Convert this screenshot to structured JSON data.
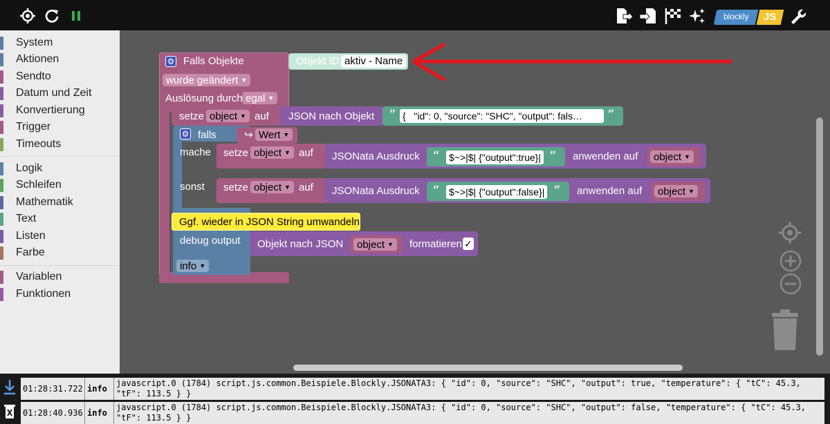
{
  "toolbar": {
    "icons_left": [
      "target-icon",
      "reload-icon",
      "pause-icon"
    ],
    "icons_right": [
      "export-icon",
      "import-icon",
      "checkered-flag-icon",
      "sparkle-icon",
      "wrench-icon"
    ],
    "mode_blockly_label": "blockly",
    "mode_js_label": "JS",
    "colors": {
      "pause": "#34b04b",
      "blockly": "#4a8cc7",
      "js": "#f4c430"
    }
  },
  "sidebar": {
    "categories": [
      {
        "label": "System",
        "color": "#5b80a5"
      },
      {
        "label": "Aktionen",
        "color": "#5b80a5"
      },
      {
        "label": "Sendto",
        "color": "#a5588a"
      },
      {
        "label": "Datum und Zeit",
        "color": "#8a5ba5"
      },
      {
        "label": "Konvertierung",
        "color": "#8a5ba5"
      },
      {
        "label": "Trigger",
        "color": "#a5588a"
      },
      {
        "label": "Timeouts",
        "color": "#8aa55b"
      },
      {
        "label": "Logik",
        "color": "#5b80a5"
      },
      {
        "label": "Schleifen",
        "color": "#5ba55b"
      },
      {
        "label": "Mathematik",
        "color": "#5b67a5"
      },
      {
        "label": "Text",
        "color": "#5ba58c"
      },
      {
        "label": "Listen",
        "color": "#745ba5"
      },
      {
        "label": "Farbe",
        "color": "#a5745b"
      },
      {
        "label": "Variablen",
        "color": "#a55b80"
      },
      {
        "label": "Funktionen",
        "color": "#995ba5"
      }
    ]
  },
  "blocks": {
    "trigger": {
      "title": "Falls Objekte",
      "field_label": "Objekt ID",
      "object_id": "aktiv - Name",
      "changed": "wurde geändert",
      "trigger_by_label": "Auslösung durch",
      "trigger_by_value": "egal"
    },
    "setze1": {
      "set": "setze",
      "var": "object",
      "auf": "auf",
      "fn": "JSON nach Objekt",
      "json": "\"id\": 0,   \"source\": \"SHC\",   \"output\": fals…",
      "json_brace": "{"
    },
    "ifblock": {
      "falls": "falls",
      "wert": "Wert",
      "mache": "mache",
      "sonst": "sonst"
    },
    "setze2": {
      "set": "setze",
      "var": "object",
      "auf": "auf",
      "fn": "JSONata Ausdruck",
      "expr": "$~>|$| {\"output\":true}|",
      "anwenden": "anwenden auf",
      "target": "object"
    },
    "setze3": {
      "set": "setze",
      "var": "object",
      "auf": "auf",
      "fn": "JSONata Ausdruck",
      "expr": "$~>|$| {\"output\":false}|",
      "anwenden": "anwenden auf",
      "target": "object"
    },
    "comment": "Ggf. wieder in JSON String umwandeln",
    "debug": {
      "label": "debug output",
      "fn": "Objekt nach JSON",
      "var": "object",
      "formatieren": "formatieren",
      "checked": "✓",
      "level": "info"
    }
  },
  "log": [
    {
      "time": "01:28:31.722",
      "level": "info",
      "message": "javascript.0 (1784) script.js.common.Beispiele.Blockly.JSONATA3: { \"id\": 0, \"source\": \"SHC\", \"output\": true, \"temperature\": { \"tC\": 45.3, \"tF\": 113.5 } }"
    },
    {
      "time": "01:28:40.936",
      "level": "info",
      "message": "javascript.0 (1784) script.js.common.Beispiele.Blockly.JSONATA3: { \"id\": 0, \"source\": \"SHC\", \"output\": false, \"temperature\": { \"tC\": 45.3, \"tF\": 113.5 } }"
    }
  ],
  "colors": {
    "trigger_block": "#a55b80",
    "object_id_block": "#c9e8dc",
    "logic_block": "#5b80a5",
    "var_block": "#a55b80",
    "convert_block": "#8a5ba5",
    "text_block": "#5ba58c",
    "comment": "#ffeb3b",
    "annotation_arrow": "#e8141b",
    "workspace": "#595959"
  }
}
